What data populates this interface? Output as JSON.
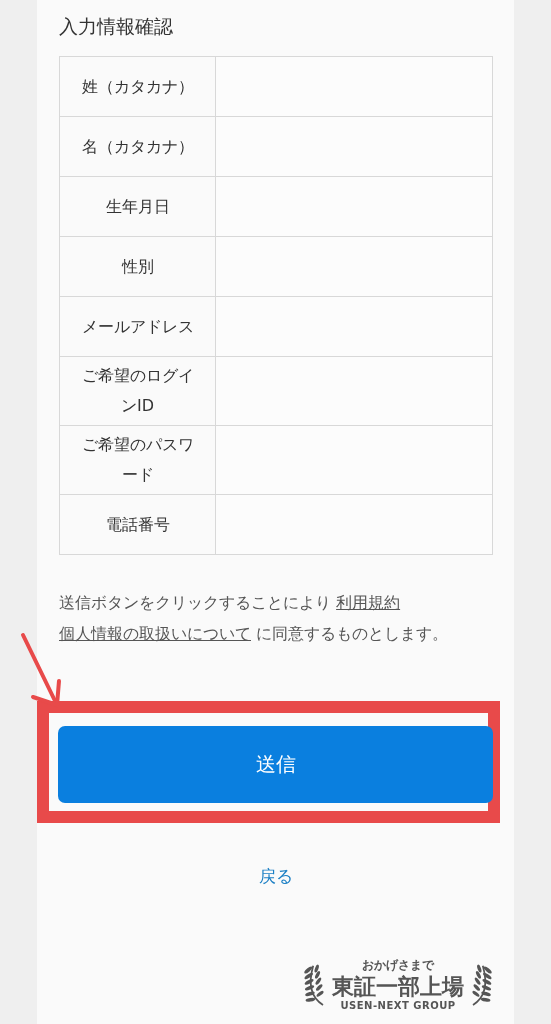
{
  "section_title": "入力情報確認",
  "rows": [
    {
      "label": "姓（カタカナ）"
    },
    {
      "label": "名（カタカナ）"
    },
    {
      "label": "生年月日"
    },
    {
      "label": "性別"
    },
    {
      "label": "メールアドレス"
    },
    {
      "label": "ご希望のログインID"
    },
    {
      "label": "ご希望のパスワード"
    },
    {
      "label": "電話番号"
    }
  ],
  "consent": {
    "before": "送信ボタンをクリックすることにより",
    "links": [
      "利用規約",
      "個人情報の取扱いについて"
    ],
    "after": "に同意するものとします。"
  },
  "submit_button": "送信",
  "back_link": "戻る",
  "badge": {
    "top": "おかげさまで",
    "main": "東証一部上場",
    "bottom": "USEN-NEXT GROUP"
  }
}
